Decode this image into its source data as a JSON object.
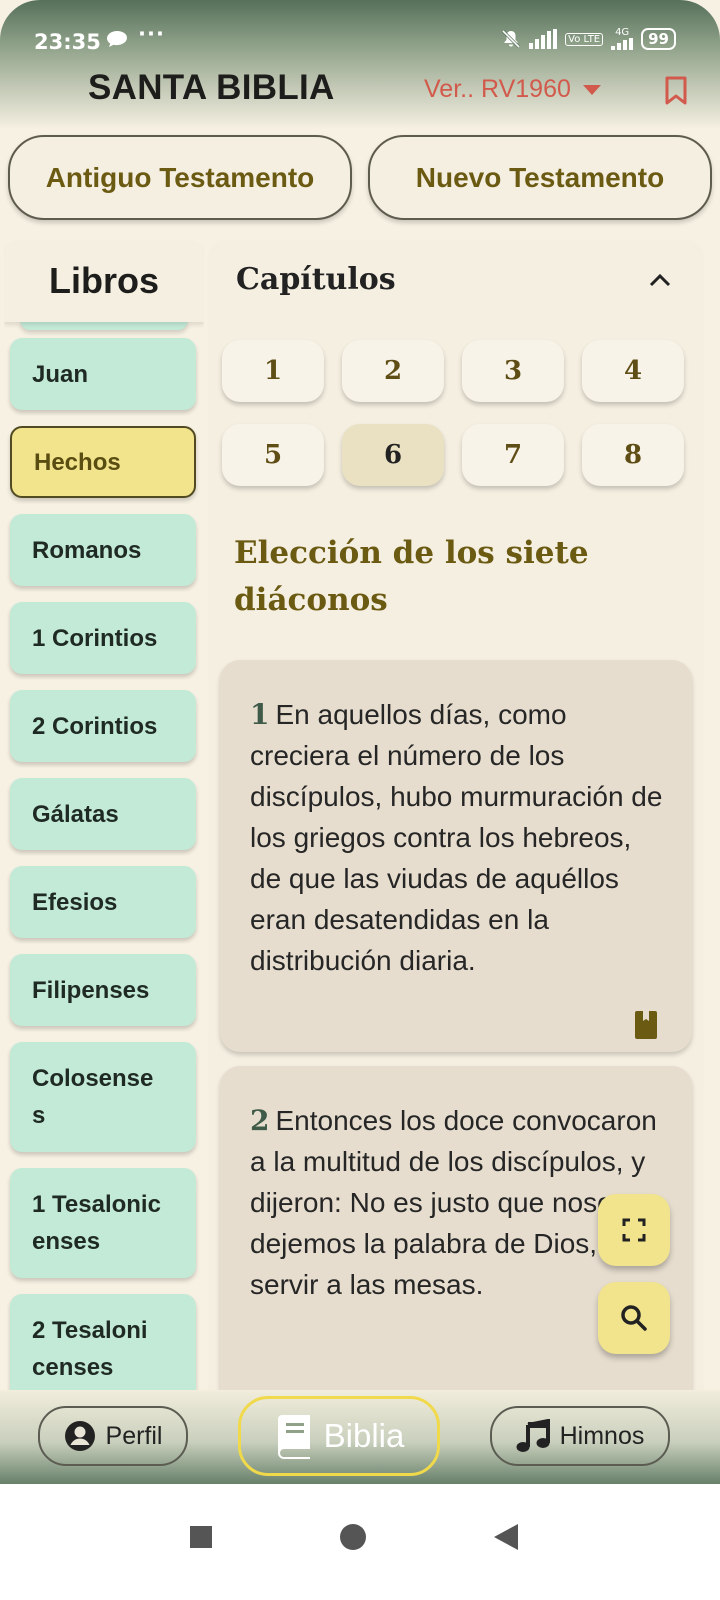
{
  "status_bar": {
    "time": "23:35",
    "dots": "···",
    "network_label": "4G",
    "volte_label": "Vo LTE",
    "battery": "99"
  },
  "header": {
    "title": "SANTA BIBLIA",
    "version": "Ver.. RV1960"
  },
  "testaments": {
    "old": "Antiguo Testamento",
    "new": "Nuevo Testamento"
  },
  "books": {
    "header": "Libros",
    "items": [
      {
        "label": "Juan",
        "active": false
      },
      {
        "label": "Hechos",
        "active": true
      },
      {
        "label": "Romanos",
        "active": false
      },
      {
        "label": "1 Corintios",
        "active": false
      },
      {
        "label": "2 Corintios",
        "active": false
      },
      {
        "label": "Gálatas",
        "active": false
      },
      {
        "label": "Efesios",
        "active": false
      },
      {
        "label": "Filipenses",
        "active": false
      },
      {
        "label": "Colosense\ns",
        "active": false
      },
      {
        "label": "1 Tesalonic\nenses",
        "active": false
      },
      {
        "label": "2 Tesaloni\ncenses",
        "active": false
      }
    ]
  },
  "chapters": {
    "header": "Capítulos",
    "numbers": [
      "1",
      "2",
      "3",
      "4",
      "5",
      "6",
      "7",
      "8"
    ],
    "selected": "6",
    "section_heading": "Elección de los siete diáconos",
    "verses": [
      {
        "number": "1",
        "text": "En aquellos días,  como creciera el número de los discípulos,  hubo murmuración de los griegos contra los hebreos,  de que las viudas de aquéllos eran desatendidas en la distribución diaria."
      },
      {
        "number": "2",
        "text": "Entonces los doce convocaron a la multitud de los discípulos,  y dijeron: No es justo que nosotros dejemos la palabra de Dios,  para servir a las mesas."
      }
    ]
  },
  "bottom_nav": {
    "profile": "Perfil",
    "bible": "Biblia",
    "hymns": "Himnos"
  },
  "colors": {
    "accent": "#6b5a12",
    "book_bg": "#c3ead7",
    "active_bg": "#f1e48c",
    "version_red": "#d25a4c"
  }
}
